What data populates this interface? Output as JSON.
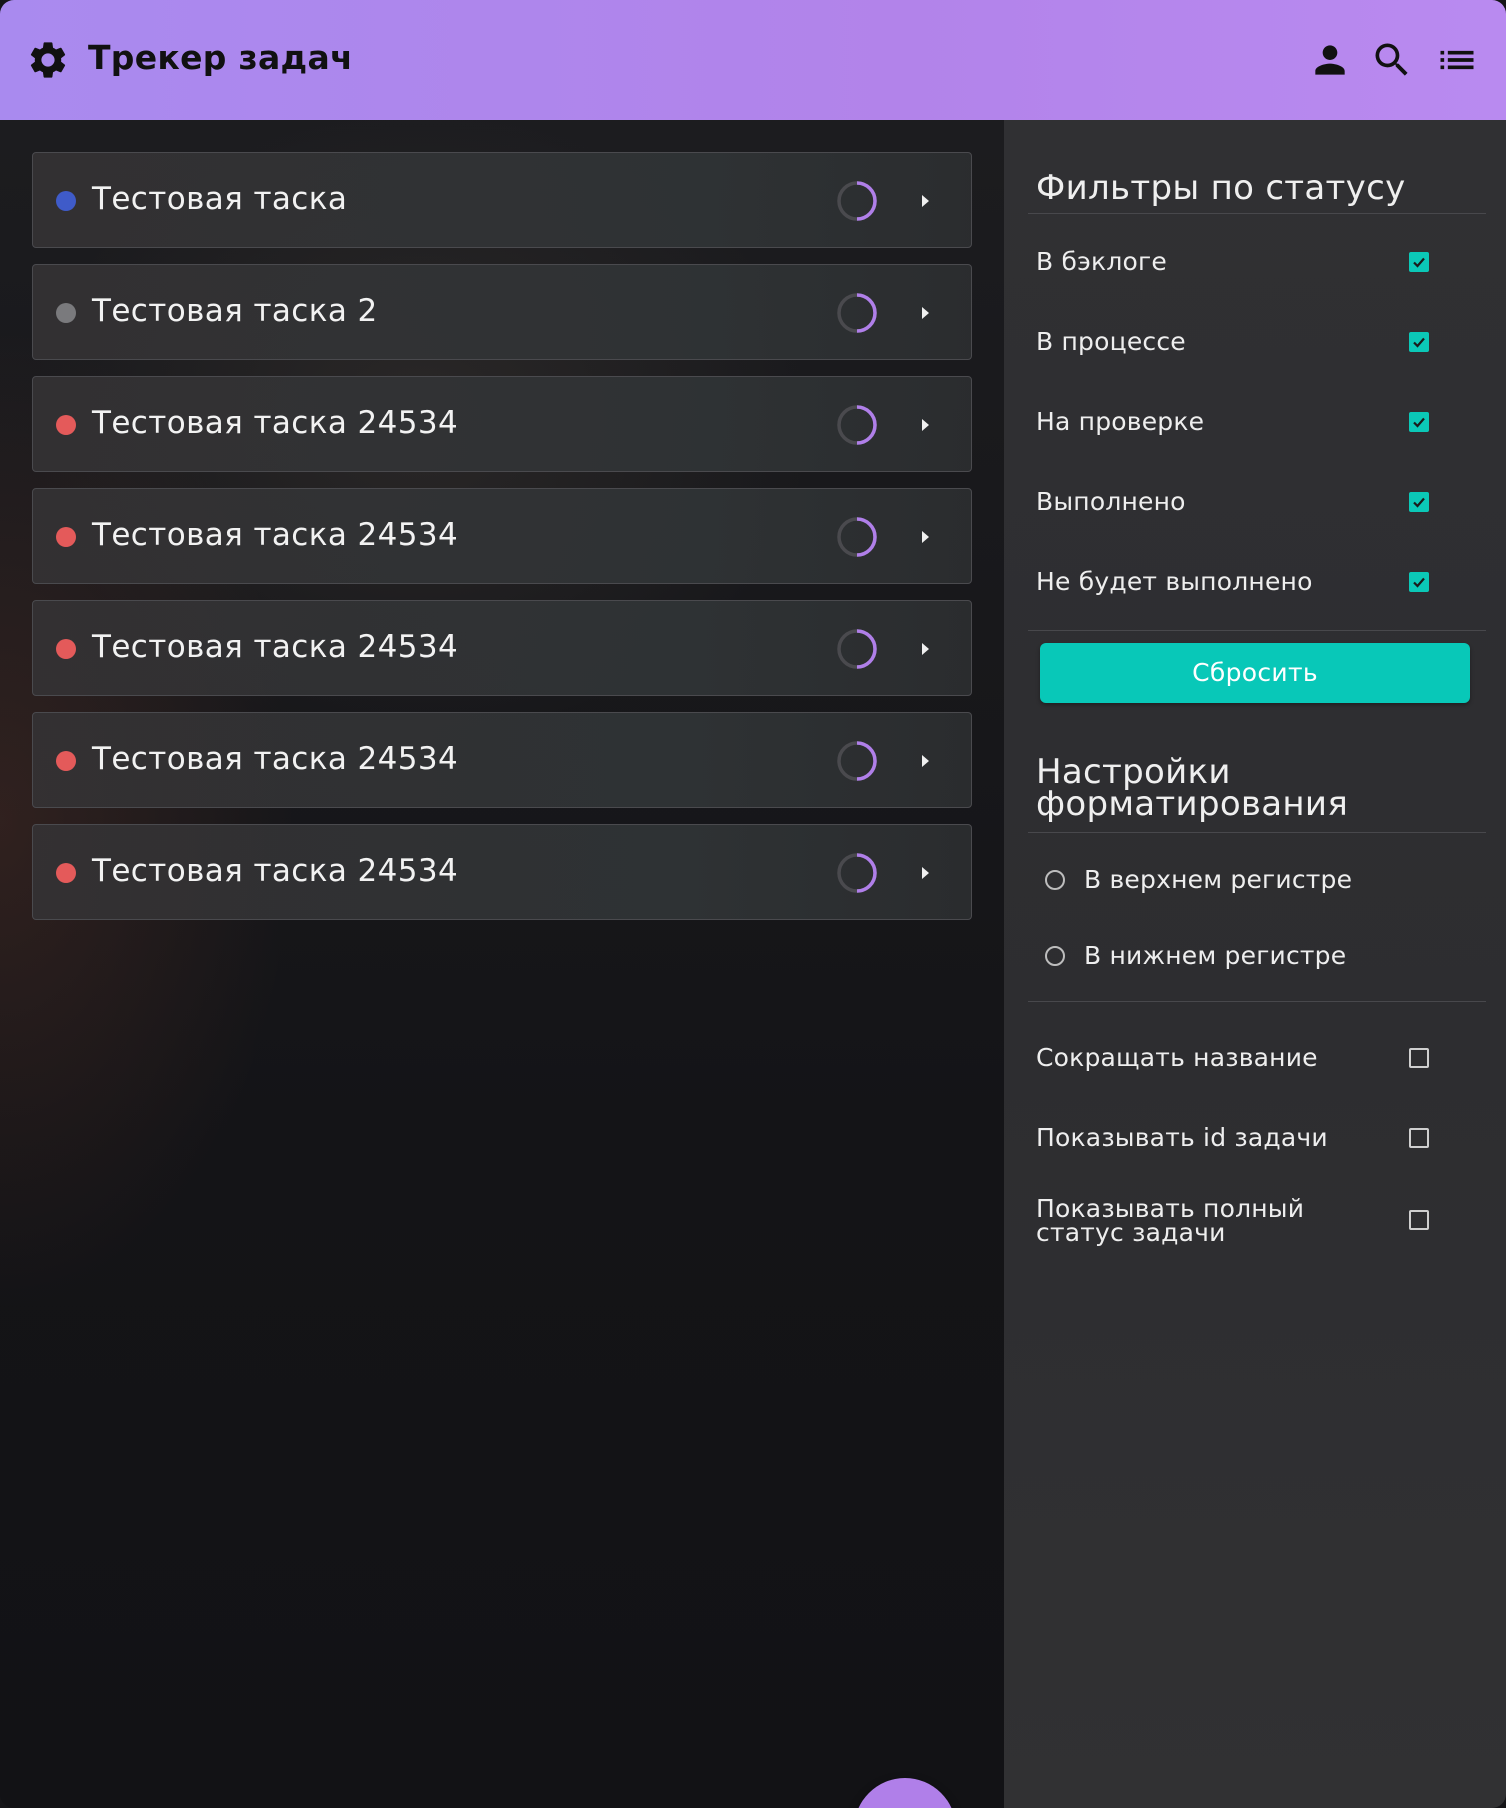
{
  "header": {
    "title": "Трекер задач",
    "icons": [
      "gear-icon",
      "user-icon",
      "search-icon",
      "list-icon"
    ]
  },
  "colors": {
    "accent": "#b07fe9",
    "teal": "#08c8b8",
    "status_blue": "#3f5bc9",
    "status_gray": "#7a7a7d",
    "status_red": "#e45a5a"
  },
  "tasks": [
    {
      "name": "Тестовая таска",
      "status_color": "#3f5bc9"
    },
    {
      "name": "Тестовая таска 2",
      "status_color": "#7a7a7d"
    },
    {
      "name": "Тестовая таска 24534",
      "status_color": "#e45a5a"
    },
    {
      "name": "Тестовая таска 24534",
      "status_color": "#e45a5a"
    },
    {
      "name": "Тестовая таска 24534",
      "status_color": "#e45a5a"
    },
    {
      "name": "Тестовая таска 24534",
      "status_color": "#e45a5a"
    },
    {
      "name": "Тестовая таска 24534",
      "status_color": "#e45a5a"
    }
  ],
  "filters": {
    "title": "Фильтры по статусу",
    "items": [
      {
        "label": "В бэклоге",
        "checked": true
      },
      {
        "label": "В процессе",
        "checked": true
      },
      {
        "label": "На проверке",
        "checked": true
      },
      {
        "label": "Выполнено",
        "checked": true
      },
      {
        "label": "Не будет выполнено",
        "checked": true
      }
    ],
    "reset_label": "Сбросить"
  },
  "formatting": {
    "title_line1": "Настройки",
    "title_line2": "форматирования",
    "radios": [
      {
        "label": "В верхнем регистре",
        "selected": false
      },
      {
        "label": "В нижнем регистре",
        "selected": false
      }
    ],
    "options": [
      {
        "label": "Сокращать название",
        "checked": false
      },
      {
        "label": "Показывать id задачи",
        "checked": false
      },
      {
        "label_line1": "Показывать полный",
        "label_line2": "статус задачи",
        "checked": false
      }
    ]
  }
}
